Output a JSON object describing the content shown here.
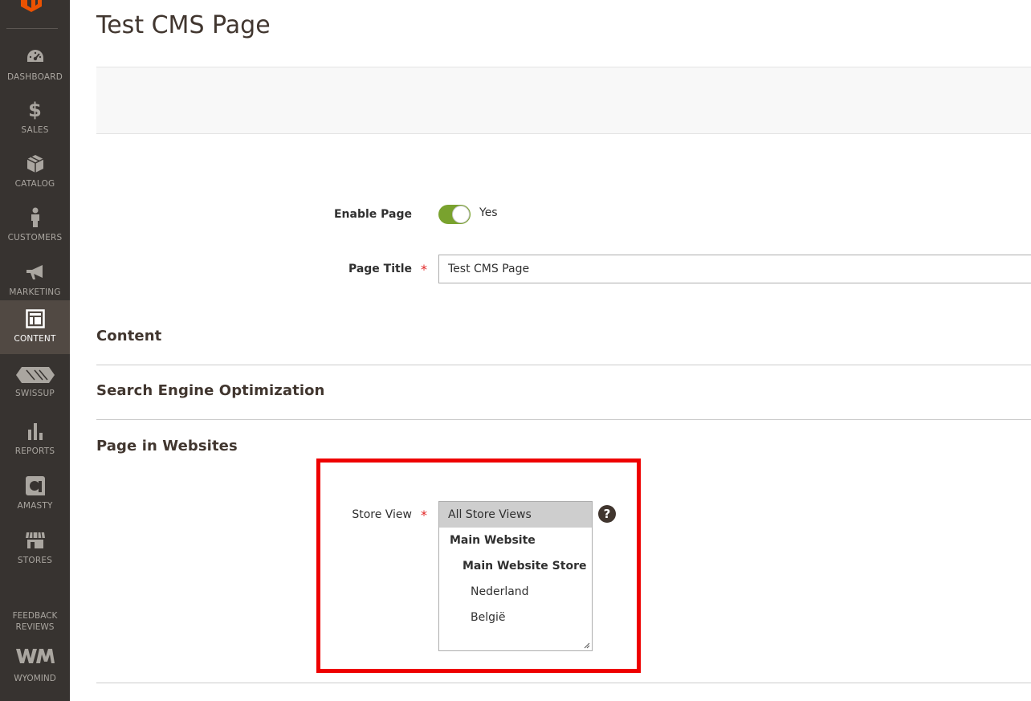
{
  "sidebar": {
    "items": [
      {
        "label": "DASHBOARD",
        "icon": "dashboard-icon"
      },
      {
        "label": "SALES",
        "icon": "dollar-icon"
      },
      {
        "label": "CATALOG",
        "icon": "box-icon"
      },
      {
        "label": "CUSTOMERS",
        "icon": "person-icon"
      },
      {
        "label": "MARKETING",
        "icon": "megaphone-icon"
      },
      {
        "label": "CONTENT",
        "icon": "layout-icon",
        "active": true
      },
      {
        "label": "SWISSUP",
        "icon": "swissup-icon"
      },
      {
        "label": "REPORTS",
        "icon": "bar-chart-icon"
      },
      {
        "label": "AMASTY",
        "icon": "amasty-icon"
      },
      {
        "label": "STORES",
        "icon": "store-icon"
      }
    ],
    "feedback_line1": "FEEDBACK",
    "feedback_line2": "REVIEWS",
    "wyomind_label": "WYOMIND"
  },
  "page": {
    "title": "Test CMS Page"
  },
  "form": {
    "enable_page_label": "Enable Page",
    "enable_page_value": "Yes",
    "page_title_label": "Page Title",
    "page_title_value": "Test CMS Page",
    "required_mark": "*"
  },
  "sections": {
    "content": "Content",
    "seo": "Search Engine Optimization",
    "websites": "Page in Websites"
  },
  "store_view": {
    "label": "Store View",
    "help": "?",
    "options": [
      {
        "label": "All Store Views",
        "selected": true
      },
      {
        "label": "Main Website",
        "bold": true
      },
      {
        "label": "Main Website Store",
        "bold": true
      },
      {
        "label": "Nederland"
      },
      {
        "label": "België"
      }
    ]
  },
  "colors": {
    "sidebar_bg": "#373330",
    "sidebar_active": "#514943",
    "toggle_on": "#79a22e",
    "required": "#e22626",
    "highlight": "#ee0000",
    "magento_orange": "#eb5202"
  }
}
